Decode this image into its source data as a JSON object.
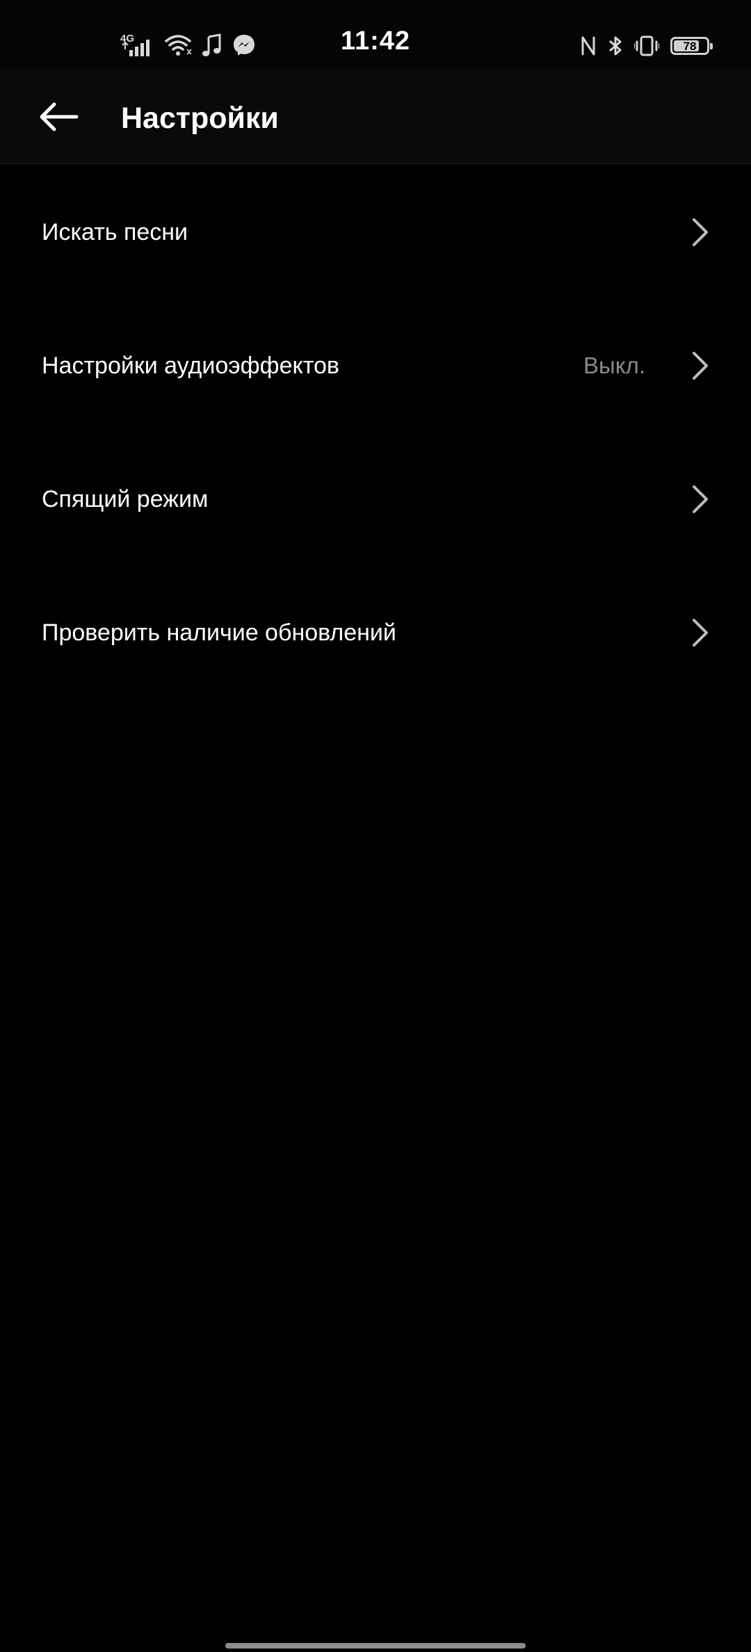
{
  "status_bar": {
    "network_type": "4G",
    "time": "11:42",
    "battery_level": "78",
    "battery_fraction": 0.78,
    "left_icons": [
      "signal-icon",
      "wifi-icon",
      "music-note-icon",
      "messenger-icon"
    ],
    "right_icons": [
      "nfc-icon",
      "bluetooth-icon",
      "vibrate-icon",
      "battery-icon"
    ]
  },
  "app_bar": {
    "title": "Настройки",
    "back_icon": "back-arrow-icon"
  },
  "settings": {
    "items": [
      {
        "label": "Искать песни",
        "value": ""
      },
      {
        "label": "Настройки аудиоэффектов",
        "value": "Выкл."
      },
      {
        "label": "Спящий режим",
        "value": ""
      },
      {
        "label": "Проверить наличие обновлений",
        "value": ""
      }
    ]
  },
  "colors": {
    "background": "#000000",
    "text_primary": "#ffffff",
    "text_secondary": "#8a8a8a",
    "chevron": "#bdbdbd"
  }
}
